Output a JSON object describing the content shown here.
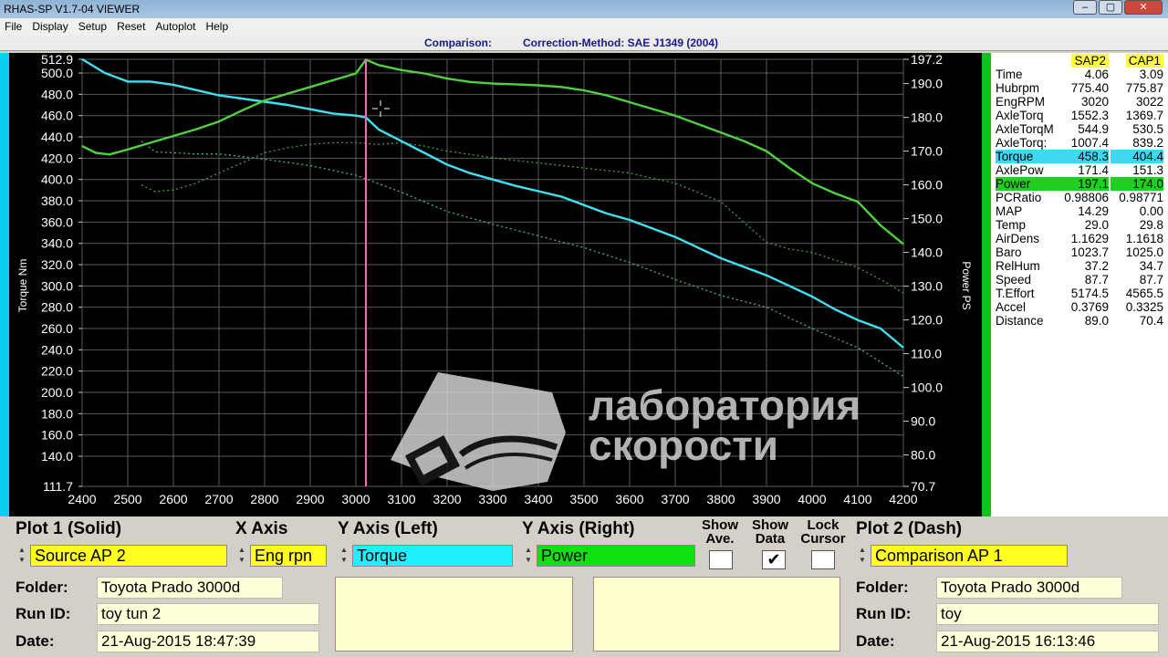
{
  "window": {
    "title": "RHAS-SP V1.7-04  VIEWER"
  },
  "menu": [
    "File",
    "Display",
    "Setup",
    "Reset",
    "Autoplot",
    "Help"
  ],
  "header": {
    "comparison_label": "Comparison:",
    "correction": "Correction-Method: SAE J1349 (2004)"
  },
  "chart_data": {
    "type": "line",
    "xlabel": "",
    "ylabel_left": "Torque Nm",
    "ylabel_right": "Power PS",
    "x_ticks": [
      2400,
      2500,
      2600,
      2700,
      2800,
      2900,
      3000,
      3100,
      3200,
      3300,
      3400,
      3500,
      3600,
      3700,
      3800,
      3900,
      4000,
      4100,
      4200
    ],
    "xlim": [
      2400,
      4200
    ],
    "ylim_left": [
      111.7,
      512.9
    ],
    "ylim_right": [
      70.7,
      197.2
    ],
    "y_left_ticks": [
      "512.9",
      "500.0",
      "480.0",
      "460.0",
      "440.0",
      "420.0",
      "400.0",
      "380.0",
      "360.0",
      "340.0",
      "320.0",
      "300.0",
      "280.0",
      "260.0",
      "240.0",
      "220.0",
      "200.0",
      "180.0",
      "160.0",
      "140.0",
      "111.7"
    ],
    "y_right_ticks": [
      "197.2",
      "190.0",
      "180.0",
      "170.0",
      "160.0",
      "150.0",
      "140.0",
      "130.0",
      "120.0",
      "110.0",
      "100.0",
      "90.0",
      "80.0",
      "70.7"
    ],
    "cursor_x": 3022,
    "grid": true,
    "series": [
      {
        "name": "Torque",
        "axis": "left",
        "style": "solid",
        "color": "#40e0f0",
        "x": [
          2400,
          2450,
          2500,
          2550,
          2600,
          2650,
          2700,
          2750,
          2800,
          2850,
          2900,
          2950,
          3000,
          3022,
          3050,
          3100,
          3150,
          3200,
          3250,
          3300,
          3350,
          3400,
          3450,
          3500,
          3550,
          3600,
          3650,
          3700,
          3750,
          3800,
          3850,
          3900,
          3950,
          4000,
          4050,
          4100,
          4150,
          4200
        ],
        "y": [
          513,
          500,
          492,
          492,
          489,
          484,
          479,
          476,
          473,
          470,
          466,
          462,
          460,
          458.3,
          447,
          436,
          425,
          414,
          406,
          400,
          394,
          389,
          384,
          376,
          368,
          362,
          354,
          346,
          336,
          326,
          318,
          310,
          300,
          290,
          278,
          268,
          260,
          242
        ]
      },
      {
        "name": "Power",
        "axis": "right",
        "style": "solid",
        "color": "#50d040",
        "x": [
          2400,
          2430,
          2460,
          2500,
          2550,
          2600,
          2650,
          2700,
          2750,
          2800,
          2850,
          2900,
          2950,
          3000,
          3022,
          3050,
          3100,
          3150,
          3200,
          3250,
          3300,
          3350,
          3400,
          3450,
          3500,
          3550,
          3600,
          3650,
          3700,
          3750,
          3800,
          3850,
          3900,
          3950,
          4000,
          4050,
          4100,
          4150,
          4200
        ],
        "y": [
          171.5,
          169.5,
          169,
          170.5,
          172.5,
          174.5,
          176.5,
          178.8,
          182,
          185,
          187,
          189,
          191,
          193,
          197.1,
          195.5,
          194,
          193,
          191.5,
          190.5,
          190,
          189.8,
          189.5,
          189,
          188,
          186.5,
          184.5,
          182.5,
          180.5,
          178,
          175.5,
          173,
          170,
          165,
          160.5,
          157.5,
          155,
          148,
          142.5
        ]
      },
      {
        "name": "Comparison Torque",
        "axis": "left",
        "style": "dash",
        "color": "#40b0a0",
        "x": [
          2530,
          2560,
          2600,
          2650,
          2700,
          2800,
          2900,
          3000,
          3100,
          3200,
          3300,
          3400,
          3500,
          3600,
          3700,
          3800,
          3900,
          4000,
          4100,
          4200
        ],
        "y": [
          436,
          426,
          425,
          424,
          424,
          419,
          413,
          404,
          388,
          370,
          358,
          347,
          336,
          322,
          306,
          291,
          280,
          260,
          242,
          215
        ]
      },
      {
        "name": "Comparison Power",
        "axis": "right",
        "style": "dash",
        "color": "#40a040",
        "x": [
          2530,
          2560,
          2600,
          2650,
          2700,
          2750,
          2800,
          2850,
          2900,
          2950,
          3000,
          3050,
          3100,
          3150,
          3200,
          3300,
          3400,
          3500,
          3600,
          3700,
          3800,
          3850,
          3900,
          3950,
          4000,
          4100,
          4150,
          4200
        ],
        "y": [
          160,
          158,
          158.5,
          160.5,
          163.5,
          166.5,
          169.5,
          171,
          172,
          172.5,
          172.5,
          172,
          172.5,
          171.5,
          170,
          168,
          166.5,
          165,
          163.5,
          160.5,
          155,
          149,
          143,
          141,
          140,
          135.5,
          132,
          128
        ]
      }
    ]
  },
  "watermark": {
    "line1": "лаборатория",
    "line2": "скорости"
  },
  "data_table": {
    "col1": "SAP2",
    "col2": "CAP1",
    "rows": [
      {
        "label": "Time",
        "v1": "4.06",
        "v2": "3.09"
      },
      {
        "label": "Hubrpm",
        "v1": "775.40",
        "v2": "775.87"
      },
      {
        "label": "EngRPM",
        "v1": "3020",
        "v2": "3022"
      },
      {
        "label": "AxleTorq",
        "v1": "1552.3",
        "v2": "1369.7"
      },
      {
        "label": "AxleTorqM",
        "v1": "544.9",
        "v2": "530.5"
      },
      {
        "label": "AxleTorq:",
        "v1": "1007.4",
        "v2": "839.2"
      },
      {
        "label": "Torque",
        "v1": "458.3",
        "v2": "404.4",
        "hl": "cyan"
      },
      {
        "label": "AxlePow",
        "v1": "171.4",
        "v2": "151.3"
      },
      {
        "label": "Power",
        "v1": "197.1",
        "v2": "174.0",
        "hl": "green"
      },
      {
        "label": "PCRatio",
        "v1": "0.98806",
        "v2": "0.98771"
      },
      {
        "label": "MAP",
        "v1": "14.29",
        "v2": "0.00"
      },
      {
        "label": "Temp",
        "v1": "29.0",
        "v2": "29.8"
      },
      {
        "label": "AirDens",
        "v1": "1.1629",
        "v2": "1.1618"
      },
      {
        "label": "Baro",
        "v1": "1023.7",
        "v2": "1025.0"
      },
      {
        "label": "RelHum",
        "v1": "37.2",
        "v2": "34.7"
      },
      {
        "label": "Speed",
        "v1": "87.7",
        "v2": "87.7"
      },
      {
        "label": "T.Effort",
        "v1": "5174.5",
        "v2": "4565.5"
      },
      {
        "label": "Accel",
        "v1": "0.3769",
        "v2": "0.3325"
      },
      {
        "label": "Distance",
        "v1": "89.0",
        "v2": "70.4"
      }
    ]
  },
  "controls": {
    "plot1_header": "Plot 1 (Solid)",
    "xaxis_header": "X Axis",
    "yleft_header": "Y Axis (Left)",
    "yright_header": "Y Axis (Right)",
    "show_ave": "Show Ave.",
    "show_data": "Show Data",
    "lock_cursor": "Lock Cursor",
    "plot2_header": "Plot 2 (Dash)",
    "plot1_source": "Source AP 2",
    "xaxis_value": "Eng rpn",
    "yleft_value": "Torque",
    "yright_value": "Power",
    "plot2_source": "Comparison AP 1",
    "show_data_checked": "✔",
    "plot1_folder_label": "Folder:",
    "plot1_folder": "Toyota Prado 3000d",
    "plot1_runid_label": "Run ID:",
    "plot1_runid": "toy tun 2",
    "plot1_date_label": "Date:",
    "plot1_date": "21-Aug-2015  18:47:39",
    "plot2_folder_label": "Folder:",
    "plot2_folder": "Toyota Prado 3000d",
    "plot2_runid_label": "Run ID:",
    "plot2_runid": "toy",
    "plot2_date_label": "Date:",
    "plot2_date": "21-Aug-2015  16:13:46"
  }
}
